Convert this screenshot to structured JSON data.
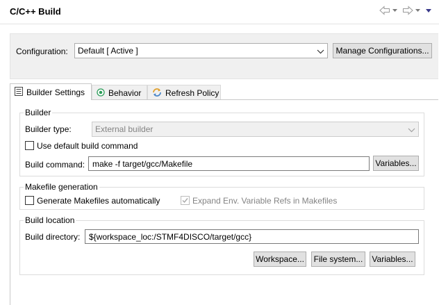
{
  "header": {
    "title": "C/C++ Build"
  },
  "configuration": {
    "label": "Configuration:",
    "selected": "Default  [ Active ]",
    "manage_button": "Manage Configurations..."
  },
  "tabs": [
    {
      "label": "Builder Settings",
      "active": true
    },
    {
      "label": "Behavior",
      "active": false
    },
    {
      "label": "Refresh Policy",
      "active": false
    }
  ],
  "builder": {
    "group_title": "Builder",
    "type_label": "Builder type:",
    "type_value": "External builder",
    "use_default_label": "Use default build command",
    "use_default_checked": false,
    "command_label": "Build command:",
    "command_value": "make -f target/gcc/Makefile",
    "variables_button": "Variables..."
  },
  "makefile": {
    "group_title": "Makefile generation",
    "generate_label": "Generate Makefiles automatically",
    "generate_checked": false,
    "expand_label": "Expand Env. Variable Refs in Makefiles",
    "expand_checked": true
  },
  "location": {
    "group_title": "Build location",
    "directory_label": "Build directory:",
    "directory_value": "${workspace_loc:/STMF4DISCO/target/gcc}",
    "workspace_button": "Workspace...",
    "filesystem_button": "File system...",
    "variables_button": "Variables..."
  },
  "colors": {
    "panel_bg": "#f0f0f0",
    "button_bg": "#e1e1e1",
    "border": "#adadad",
    "disabled_text": "#838383",
    "behavior_icon": "#2e9e5b",
    "refresh_icon": "#e1a02d"
  }
}
